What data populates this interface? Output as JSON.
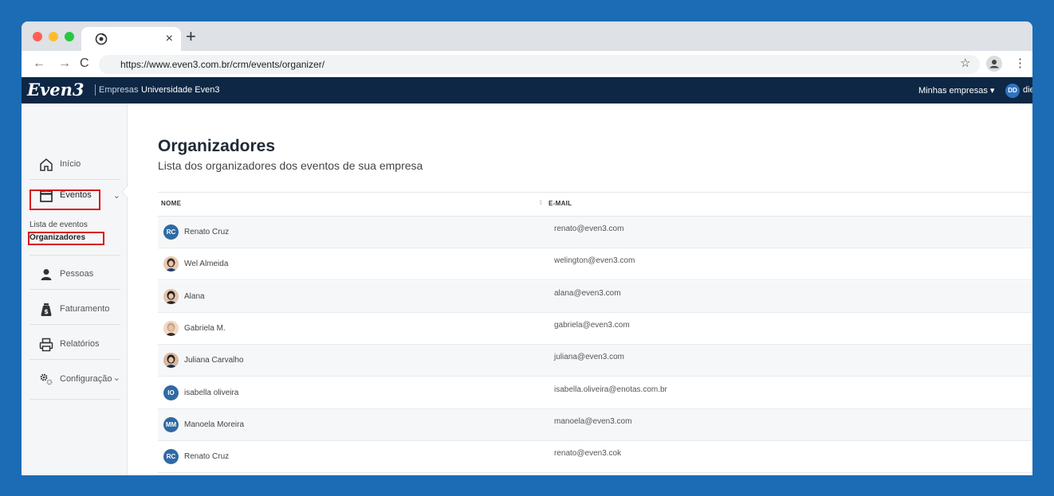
{
  "browser": {
    "url": "https://www.even3.com.br/crm/events/organizer/",
    "tab_close": "×",
    "new_tab": "+",
    "back": "←",
    "forward": "→",
    "reload": "C",
    "star": "☆",
    "menu": "⋮"
  },
  "header": {
    "logo": "Even3",
    "links": [
      "Empresas",
      "Universidade Even3"
    ],
    "companies": "Minhas empresas ▾",
    "user_initials": "DD",
    "user_name": "die"
  },
  "sidebar": {
    "items": [
      {
        "label": "Início",
        "icon": "home-icon"
      },
      {
        "label": "Eventos",
        "icon": "calendar-icon",
        "chevron": "⌄"
      },
      {
        "label": "Pessoas",
        "icon": "person-icon"
      },
      {
        "label": "Faturamento",
        "icon": "money-bag-icon"
      },
      {
        "label": "Relatórios",
        "icon": "printer-icon"
      },
      {
        "label": "Configuração",
        "icon": "gears-icon",
        "chevron": "⌄"
      }
    ],
    "subitems": [
      "Lista de eventos",
      "Organizadores"
    ]
  },
  "main": {
    "title": "Organizadores",
    "subtitle": "Lista dos organizadores dos eventos de sua empresa",
    "columns": [
      "NOME",
      "E-MAIL"
    ],
    "sort_icon": "⇕",
    "rows": [
      {
        "initials": "RC",
        "photo": false,
        "name": "Renato Cruz",
        "email": "renato@even3.com"
      },
      {
        "initials": "",
        "photo": true,
        "name": "Wel Almeida",
        "email": "welington@even3.com"
      },
      {
        "initials": "",
        "photo": true,
        "name": "Alana",
        "email": "alana@even3.com"
      },
      {
        "initials": "",
        "photo": true,
        "name": "Gabriela M.",
        "email": "gabriela@even3.com"
      },
      {
        "initials": "",
        "photo": true,
        "name": "Juliana Carvalho",
        "email": "juliana@even3.com"
      },
      {
        "initials": "IO",
        "photo": false,
        "name": "isabella oliveira",
        "email": "isabella.oliveira@enotas.com.br"
      },
      {
        "initials": "MM",
        "photo": false,
        "name": "Manoela Moreira",
        "email": "manoela@even3.com"
      },
      {
        "initials": "RC",
        "photo": false,
        "name": "Renato Cruz",
        "email": "renato@even3.cok"
      }
    ]
  },
  "colors": {
    "background": "#1b6cb5",
    "header": "#0d2745",
    "highlight": "#d8141e",
    "avatar": "#2f6aa3"
  }
}
